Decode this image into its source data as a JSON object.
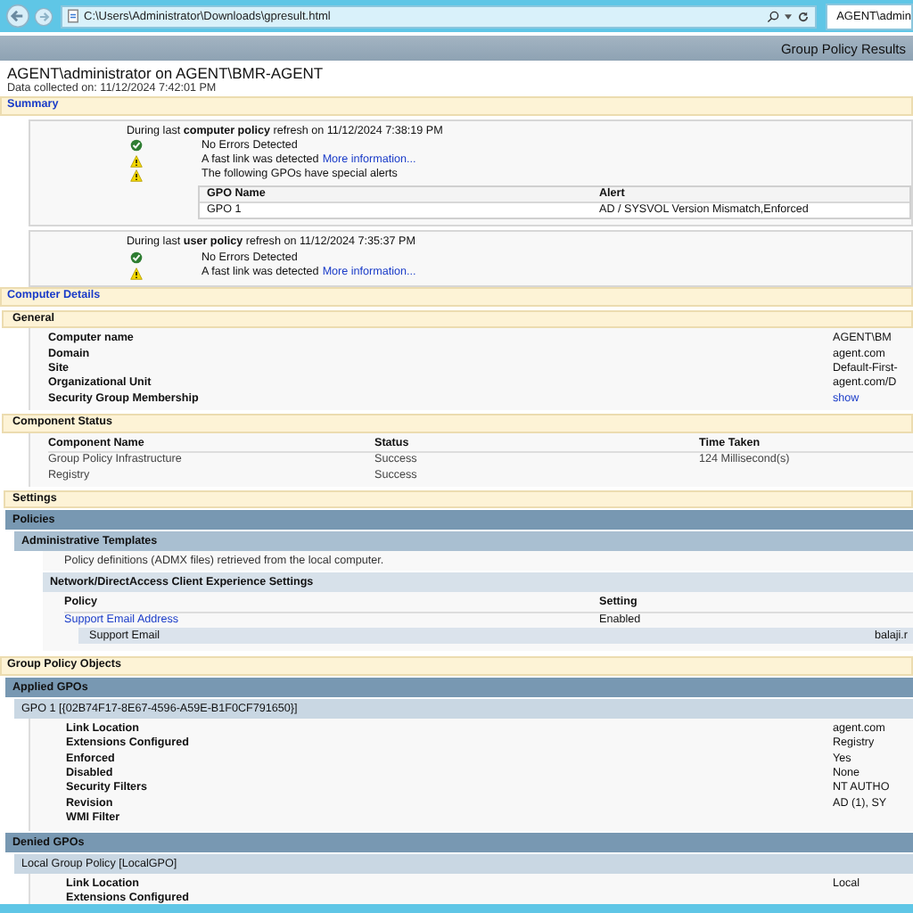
{
  "browser": {
    "address": "C:\\Users\\Administrator\\Downloads\\gpresult.html",
    "tab_title": "AGENT\\admin"
  },
  "report": {
    "bar_title": "Group Policy Results",
    "heading": "AGENT\\administrator on AGENT\\BMR-AGENT",
    "collected": "Data collected on: 11/12/2024 7:42:01 PM"
  },
  "summary": {
    "title": "Summary",
    "blocks": [
      {
        "intro": "During last **computer policy** refresh on 11/12/2024 7:38:19 PM",
        "messages": [
          {
            "kind": "ok",
            "text": "No Errors Detected"
          },
          {
            "kind": "warning",
            "text": "A fast link was detected",
            "link": "More information..."
          },
          {
            "kind": "warning",
            "text": "The following GPOs have special alerts"
          }
        ],
        "alerts": {
          "columns": [
            "GPO Name",
            "Alert"
          ],
          "rows": [
            [
              "GPO 1",
              "AD / SYSVOL Version Mismatch,Enforced"
            ]
          ]
        }
      },
      {
        "intro": "During last **user policy** refresh on 11/12/2024 7:35:37 PM",
        "messages": [
          {
            "kind": "ok",
            "text": "No Errors Detected"
          },
          {
            "kind": "warning",
            "text": "A fast link was detected",
            "link": "More information..."
          }
        ]
      }
    ]
  },
  "computer_details": {
    "title": "Computer Details",
    "general": {
      "title": "General",
      "rows": [
        {
          "label": "Computer name",
          "value": "AGENT\\BM",
          "link": false
        },
        {
          "label": "Domain",
          "value": "agent.com",
          "link": false
        },
        {
          "label": "Site",
          "value": "Default-First-",
          "link": false
        },
        {
          "label": "Organizational Unit",
          "value": "agent.com/D",
          "link": false
        },
        {
          "label": "Security Group Membership",
          "value": "show",
          "link": true
        }
      ]
    },
    "component_status": {
      "title": "Component Status",
      "columns": [
        "Component Name",
        "Status",
        "Time Taken"
      ],
      "rows": [
        [
          "Group Policy Infrastructure",
          "Success",
          "124 Millisecond(s)"
        ],
        [
          "Registry",
          "Success"
        ]
      ]
    },
    "settings": {
      "title": "Settings",
      "policies": {
        "title": "Policies",
        "templates": {
          "title": "Administrative Templates",
          "note": "Policy definitions (ADMX files) retrieved from the local computer.",
          "category": {
            "title": "Network/DirectAccess Client Experience Settings",
            "columns": [
              "Policy",
              "Setting"
            ],
            "policy": "Support Email Address",
            "setting": "Enabled",
            "detail_label": "Support Email",
            "detail_value": "balaji.r"
          }
        }
      }
    }
  },
  "gpo": {
    "title": "Group Policy Objects",
    "groups": [
      {
        "title": "Applied GPOs",
        "items": [
          {
            "title": "GPO 1 [{02B74F17-8E67-4596-A59E-B1F0CF791650}]",
            "rows": [
              {
                "label": "Link Location",
                "value": "agent.com"
              },
              {
                "label": "Extensions Configured",
                "value": "Registry"
              },
              {
                "label": "Enforced",
                "value": "Yes"
              },
              {
                "label": "Disabled",
                "value": "None"
              },
              {
                "label": "Security Filters",
                "value": "NT AUTHO"
              },
              {
                "label": "Revision",
                "value": "AD (1), SY"
              },
              {
                "label": "WMI Filter"
              }
            ]
          }
        ]
      },
      {
        "title": "Denied GPOs",
        "items": [
          {
            "title": "Local Group Policy [LocalGPO]",
            "rows": [
              {
                "label": "Link Location",
                "value": "Local"
              },
              {
                "label": "Extensions Configured"
              }
            ]
          }
        ]
      }
    ]
  }
}
